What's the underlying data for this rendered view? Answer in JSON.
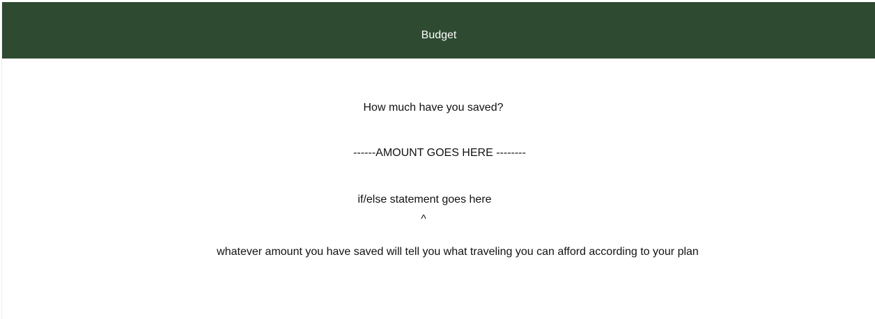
{
  "header": {
    "title": "Budget"
  },
  "main": {
    "question": "How much have you saved?",
    "amount_placeholder": "------AMOUNT GOES HERE --------",
    "ifelse_note": "if/else statement goes here",
    "caret": "^",
    "description": "whatever amount you have saved will tell you what traveling you can afford according to your plan"
  },
  "colors": {
    "header_background": "#2e4a31",
    "header_text": "#ffffff",
    "page_background": "#ffffff",
    "body_text": "#111111"
  }
}
